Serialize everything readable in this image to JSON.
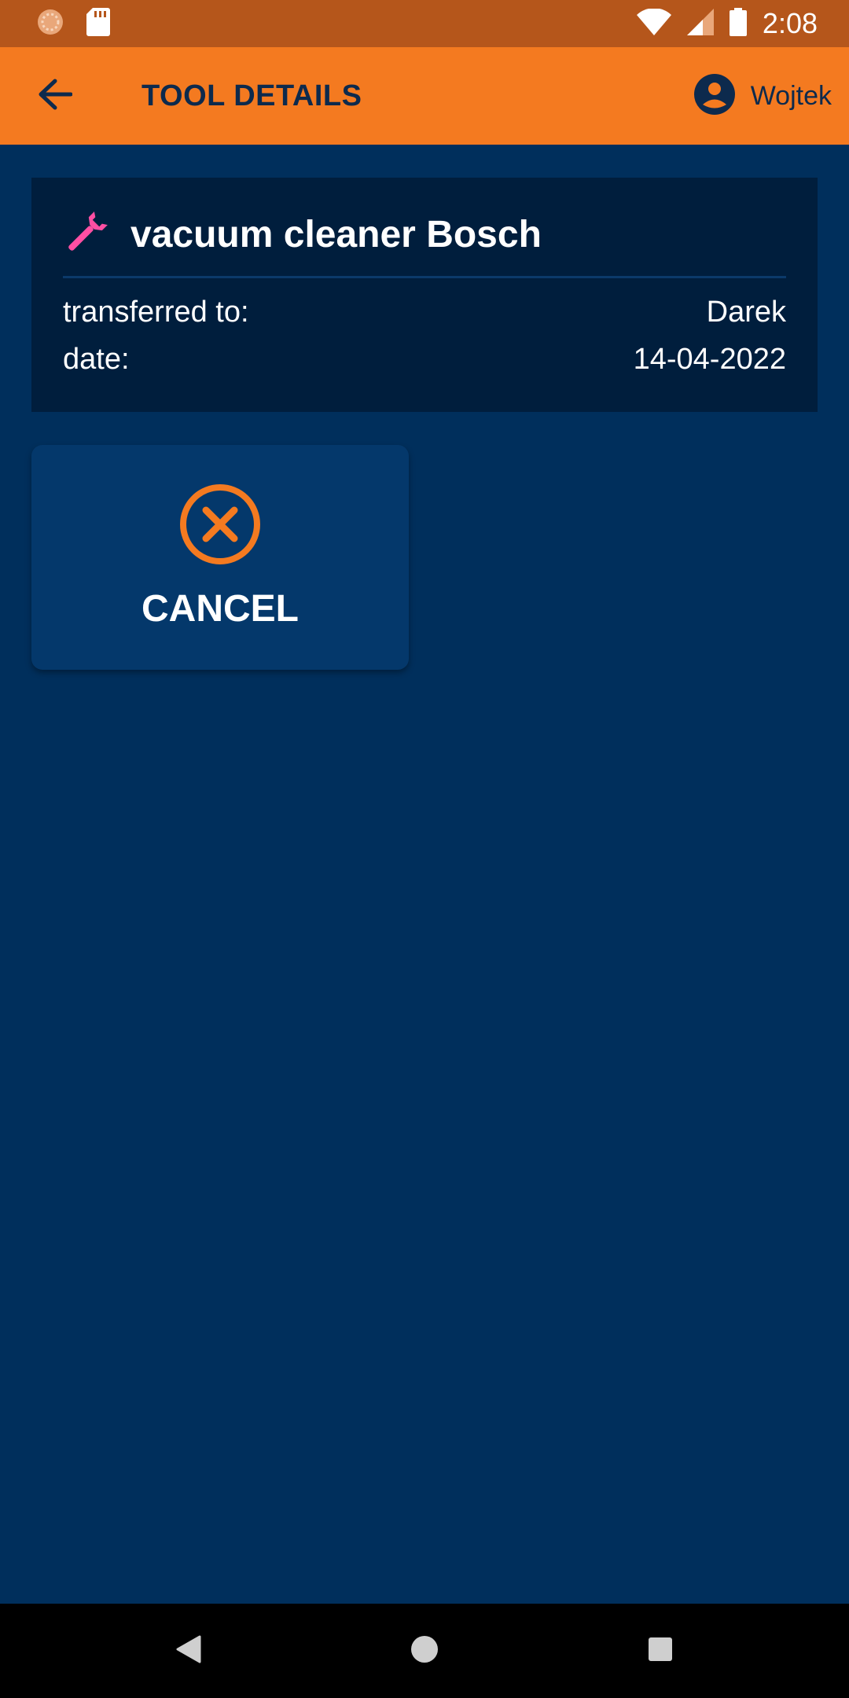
{
  "status_bar": {
    "time": "2:08",
    "icons": [
      "loading-indicator-icon",
      "sd-card-icon",
      "wifi-icon",
      "cell-signal-icon",
      "battery-icon"
    ]
  },
  "app_bar": {
    "title": "TOOL DETAILS",
    "back_icon": "arrow-left-icon",
    "user": {
      "icon": "account-circle-icon",
      "name": "Wojtek"
    },
    "colors": {
      "background": "#f47a20",
      "text": "#0d2a4d"
    }
  },
  "tool": {
    "icon": "wrench-icon",
    "icon_color": "#ff4fa3",
    "name": "vacuum cleaner Bosch",
    "rows": [
      {
        "label": "transferred to:",
        "value": "Darek"
      },
      {
        "label": "date:",
        "value": "14-04-2022"
      }
    ]
  },
  "actions": {
    "cancel": {
      "icon": "cancel-circle-icon",
      "icon_color": "#f47a20",
      "label": "CANCEL"
    }
  },
  "nav_bar": {
    "buttons": [
      "back-triangle-icon",
      "home-circle-icon",
      "recents-square-icon"
    ]
  },
  "colors": {
    "page_background": "#002f5c",
    "card_background": "#001e3d",
    "tile_background": "#04386b",
    "status_bar": "#b5561b"
  }
}
